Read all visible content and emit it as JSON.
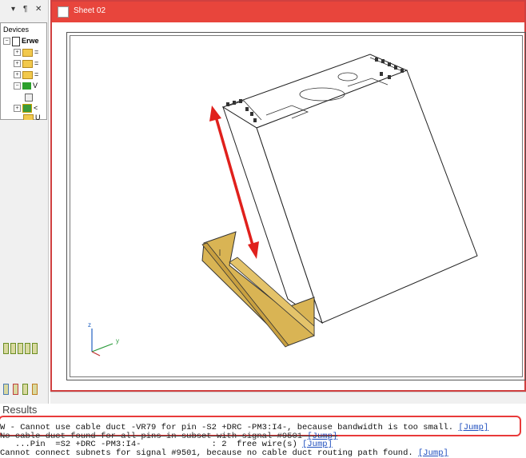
{
  "left_panel": {
    "buttons": [
      "▾",
      "¶",
      "✕"
    ],
    "devices_title": "Devices",
    "tree": [
      {
        "label": "Erwe",
        "kind": "root"
      },
      {
        "label": "=",
        "kind": "folder"
      },
      {
        "label": "=",
        "kind": "folder"
      },
      {
        "label": "=",
        "kind": "folder"
      },
      {
        "label": "V",
        "kind": "device"
      },
      {
        "label": "",
        "kind": "sub"
      },
      {
        "label": "<",
        "kind": "device2"
      },
      {
        "label": "U",
        "kind": "folder"
      }
    ]
  },
  "document": {
    "tab_label": "Sheet 02"
  },
  "results": {
    "title": "Results",
    "lines": [
      {
        "text": "W - Cannot use cable duct -VR79 for pin -S2 +DRC -PM3:I4-, because bandwidth is too small. ",
        "link": "[Jump]"
      },
      {
        "text": "No cable duct found for all pins in subset with signal #9501 ",
        "link": "[Jump]"
      },
      {
        "text": "   ...Pin  =S2 +DRC -PM3:I4-              : 2  free wire(s) ",
        "link": "[Jump]"
      },
      {
        "text": "Cannot connect subnets for signal #9501, because no cable duct routing path found. ",
        "link": "[Jump]"
      }
    ]
  },
  "axes_labels": {
    "z": "z",
    "y": "y"
  },
  "colors": {
    "tab": "#e8453c",
    "highlight": "#e83a3a",
    "arrow": "#e0201c",
    "duct": "#d9b454"
  }
}
